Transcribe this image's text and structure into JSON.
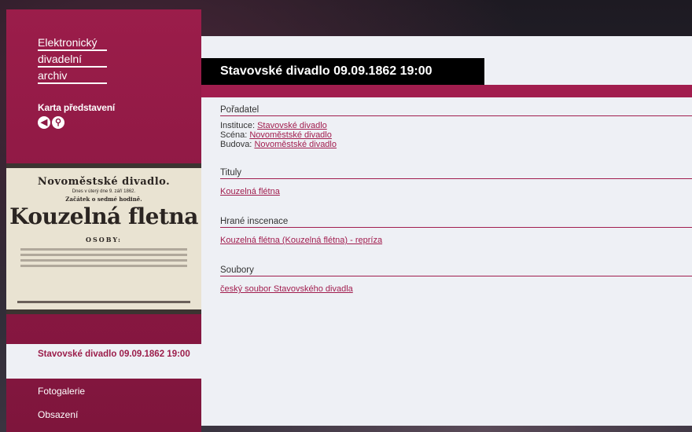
{
  "logo": {
    "line1": "Elektronický",
    "line2": "divadelní",
    "line3": "archiv"
  },
  "sidebar": {
    "card_label": "Karta představení",
    "back_glyph": "◀",
    "search_glyph": "⚲"
  },
  "poster": {
    "heading": "Novoměstské divadlo.",
    "subline": "Dnes v úterý dne 9. září 1862.",
    "start_line": "Začátek o sedmé hodině.",
    "play_title": "Kouzelná fletna",
    "cast_label": "OSOBY:"
  },
  "nav": {
    "active": "Stavovské divadlo 09.09.1862 19:00",
    "items": [
      "Fotogalerie",
      "Obsazení"
    ]
  },
  "main": {
    "title": "Stavovské divadlo 09.09.1862 19:00",
    "organizer": {
      "heading": "Pořadatel",
      "institution_label": "Instituce:",
      "institution": "Stavovské divadlo",
      "stage_label": "Scéna:",
      "stage": "Novoměstské divadlo",
      "building_label": "Budova:",
      "building": "Novoměstské divadlo"
    },
    "titles": {
      "heading": "Tituly",
      "items": [
        "Kouzelná flétna"
      ]
    },
    "productions": {
      "heading": "Hrané inscenace",
      "items": [
        "Kouzelná flétna (Kouzelná flétna) - repríza"
      ]
    },
    "ensembles": {
      "heading": "Soubory",
      "items": [
        "český soubor Stavovského divadla"
      ]
    }
  },
  "colors": {
    "accent": "#a11d4e",
    "sidebar": "#8c1843",
    "content_bg": "#eef0f5"
  }
}
